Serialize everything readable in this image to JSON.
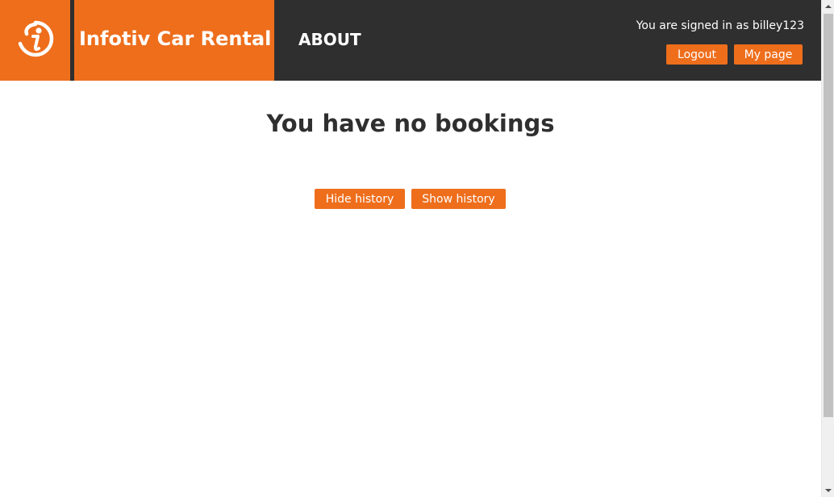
{
  "header": {
    "brand_title": "Infotiv Car Rental",
    "nav_about": "ABOUT",
    "signed_in_text": "You are signed in as billey123",
    "logout_label": "Logout",
    "mypage_label": "My page"
  },
  "main": {
    "heading": "You have no bookings",
    "hide_history_label": "Hide history",
    "show_history_label": "Show history"
  },
  "colors": {
    "accent": "#ee6e1c",
    "header_bg": "#2f2f2f",
    "text_dark": "#2f2f2f"
  },
  "icons": {
    "logo": "infotiv-logo-icon",
    "scroll_up": "scroll-up-arrow-icon",
    "scroll_down": "scroll-down-arrow-icon"
  }
}
